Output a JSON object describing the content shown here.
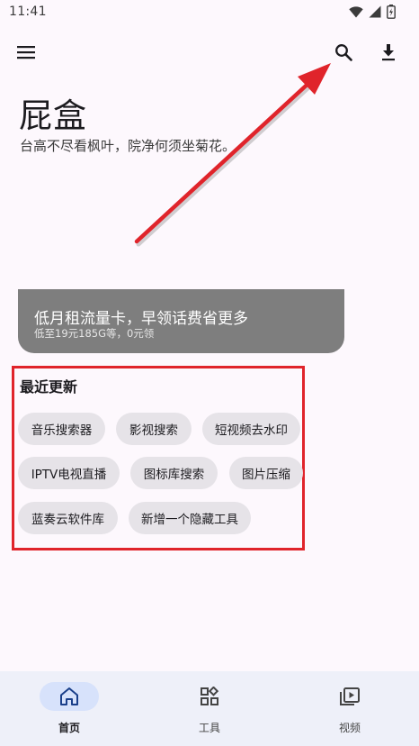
{
  "status_bar": {
    "time": "11:41",
    "icons": [
      "wifi-icon",
      "signal-icon",
      "battery-icon"
    ]
  },
  "top_bar": {
    "icons": [
      "menu-icon",
      "search-icon",
      "download-icon"
    ]
  },
  "header": {
    "title": "屁盒",
    "subtitle": "台高不尽看枫叶，院净何须坐菊花。"
  },
  "promo": {
    "title": "低月租流量卡，早领话费省更多",
    "subtitle": "低至19元185G等，0元领"
  },
  "recent": {
    "title": "最近更新",
    "chips": [
      "音乐搜索器",
      "影视搜索",
      "短视频去水印",
      "IPTV电视直播",
      "图标库搜索",
      "图片压缩",
      "蓝奏云软件库",
      "新增一个隐藏工具"
    ]
  },
  "bottom_nav": {
    "items": [
      {
        "label": "首页",
        "icon": "home-icon",
        "active": true
      },
      {
        "label": "工具",
        "icon": "apps-icon",
        "active": false
      },
      {
        "label": "视频",
        "icon": "video-library-icon",
        "active": false
      }
    ]
  },
  "colors": {
    "background": "#fdf8fd",
    "annotation_red": "#e0242b",
    "promo_bg": "#7e7e7e",
    "chip_bg": "#e6e3e8",
    "nav_bg": "#eef0f9",
    "nav_active_pill": "#d7e2fb"
  }
}
